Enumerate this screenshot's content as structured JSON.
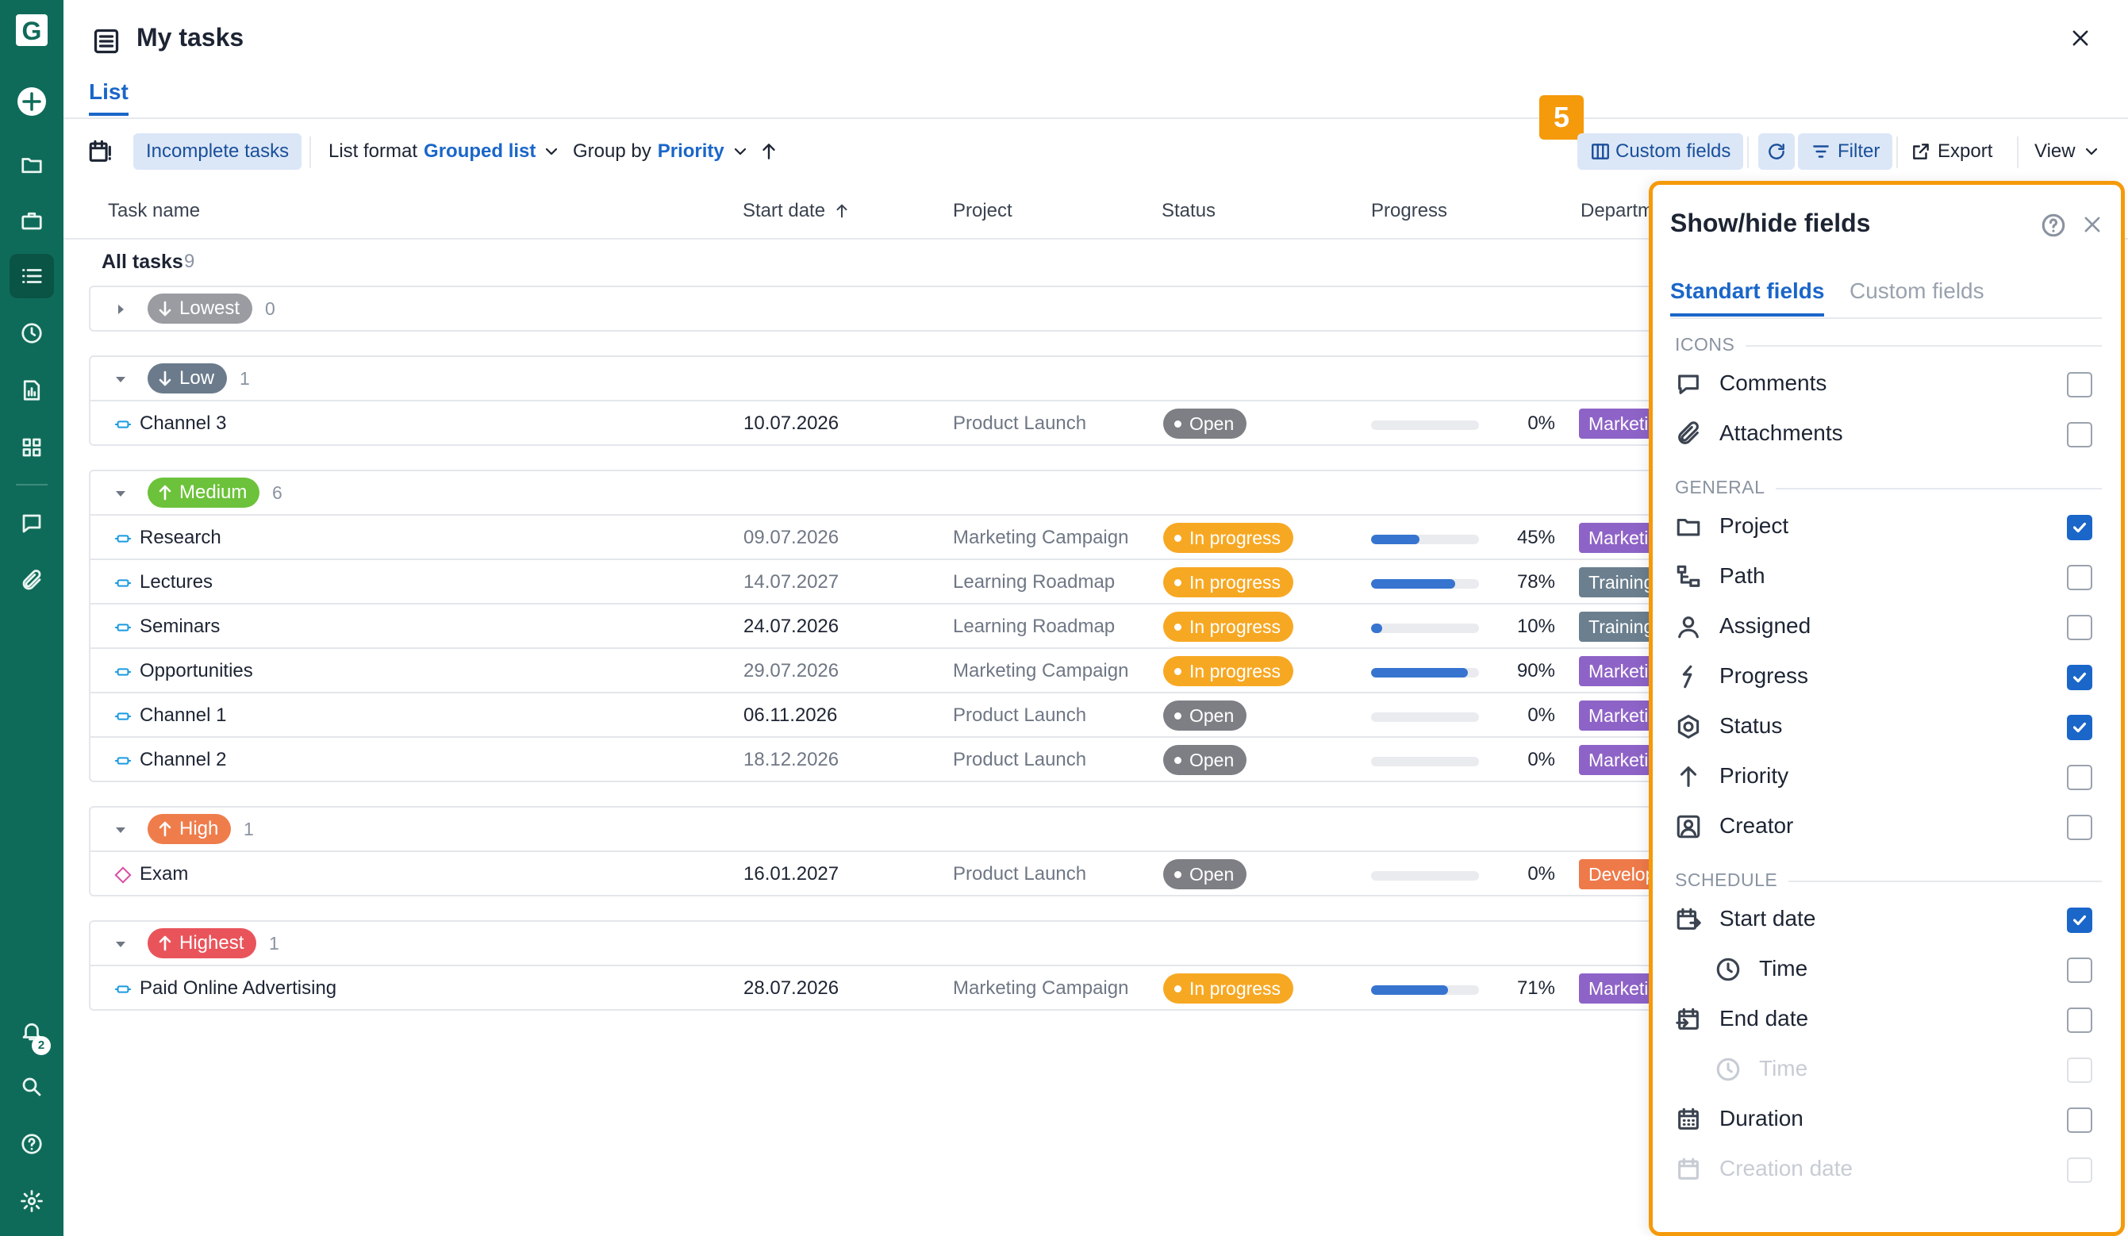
{
  "app": {
    "logo_letter": "G"
  },
  "header": {
    "title": "My tasks",
    "tab": "List",
    "step_badge": "5"
  },
  "toolbar": {
    "incomplete": "Incomplete tasks",
    "list_format_label": "List format",
    "list_format_value": "Grouped list",
    "group_by_label": "Group by",
    "group_by_value": "Priority",
    "custom_fields": "Custom fields",
    "filter": "Filter",
    "export": "Export",
    "view": "View"
  },
  "columns": [
    "Task name",
    "Start date",
    "Project",
    "Status",
    "Progress",
    "Department"
  ],
  "summary": {
    "label": "All tasks",
    "count": "9"
  },
  "groups": [
    {
      "priority": "Lowest",
      "count": "0",
      "color": "#9a9ca2",
      "collapsed": true,
      "arrow": "down",
      "tasks": []
    },
    {
      "priority": "Low",
      "count": "1",
      "color": "#6b7b8c",
      "collapsed": false,
      "arrow": "down",
      "tasks": [
        {
          "name": "Channel 3",
          "start": "10.07.2026",
          "start_dark": true,
          "project": "Product Launch",
          "status": "Open",
          "progress": 0,
          "progress_text": "0%",
          "department": "Marketing",
          "dept_color": "#8e63c7"
        }
      ]
    },
    {
      "priority": "Medium",
      "count": "6",
      "color": "#6cc23a",
      "collapsed": false,
      "arrow": "up",
      "tasks": [
        {
          "name": "Research",
          "start": "09.07.2026",
          "start_dark": false,
          "project": "Marketing Campaign",
          "status": "In progress",
          "progress": 45,
          "progress_text": "45%",
          "department": "Marketing",
          "dept_color": "#8e63c7"
        },
        {
          "name": "Lectures",
          "start": "14.07.2027",
          "start_dark": false,
          "project": "Learning Roadmap",
          "status": "In progress",
          "progress": 78,
          "progress_text": "78%",
          "department": "Training",
          "dept_color": "#6b7f8e"
        },
        {
          "name": "Seminars",
          "start": "24.07.2026",
          "start_dark": true,
          "project": "Learning Roadmap",
          "status": "In progress",
          "progress": 10,
          "progress_text": "10%",
          "department": "Training",
          "dept_color": "#6b7f8e"
        },
        {
          "name": "Opportunities",
          "start": "29.07.2026",
          "start_dark": false,
          "project": "Marketing Campaign",
          "status": "In progress",
          "progress": 90,
          "progress_text": "90%",
          "department": "Marketing",
          "dept_color": "#8e63c7"
        },
        {
          "name": "Channel 1",
          "start": "06.11.2026",
          "start_dark": true,
          "project": "Product Launch",
          "status": "Open",
          "progress": 0,
          "progress_text": "0%",
          "department": "Marketing",
          "dept_color": "#8e63c7"
        },
        {
          "name": "Channel 2",
          "start": "18.12.2026",
          "start_dark": false,
          "project": "Product Launch",
          "status": "Open",
          "progress": 0,
          "progress_text": "0%",
          "department": "Marketing",
          "dept_color": "#8e63c7"
        }
      ]
    },
    {
      "priority": "High",
      "count": "1",
      "color": "#ef7d4c",
      "collapsed": false,
      "arrow": "up",
      "tasks": [
        {
          "name": "Exam",
          "start": "16.01.2027",
          "start_dark": true,
          "project": "Product Launch",
          "status": "Open",
          "progress": 0,
          "progress_text": "0%",
          "department": "Development",
          "dept_color": "#ee7a4a",
          "milestone": true
        }
      ]
    },
    {
      "priority": "Highest",
      "count": "1",
      "color": "#e9545b",
      "collapsed": false,
      "arrow": "up",
      "tasks": [
        {
          "name": "Paid Online Advertising",
          "start": "28.07.2026",
          "start_dark": true,
          "project": "Marketing Campaign",
          "status": "In progress",
          "progress": 71,
          "progress_text": "71%",
          "department": "Marketing",
          "dept_color": "#8e63c7"
        }
      ]
    }
  ],
  "panel": {
    "title": "Show/hide fields",
    "tab_standard": "Standart fields",
    "tab_custom": "Custom fields",
    "sections": [
      {
        "title": "ICONS",
        "fields": [
          {
            "label": "Comments",
            "icon": "comment-icon",
            "checked": false
          },
          {
            "label": "Attachments",
            "icon": "paperclip-icon",
            "checked": false
          }
        ]
      },
      {
        "title": "GENERAL",
        "fields": [
          {
            "label": "Project",
            "icon": "folder-icon",
            "checked": true
          },
          {
            "label": "Path",
            "icon": "path-icon",
            "checked": false
          },
          {
            "label": "Assigned",
            "icon": "person-icon",
            "checked": false
          },
          {
            "label": "Progress",
            "icon": "progress-icon",
            "checked": true
          },
          {
            "label": "Status",
            "icon": "status-icon",
            "checked": true
          },
          {
            "label": "Priority",
            "icon": "arrow-up-icon",
            "checked": false
          },
          {
            "label": "Creator",
            "icon": "creator-icon",
            "checked": false
          }
        ]
      },
      {
        "title": "SCHEDULE",
        "fields": [
          {
            "label": "Start date",
            "icon": "calendar-start-icon",
            "checked": true
          },
          {
            "label": "Time",
            "icon": "clock-icon",
            "checked": false,
            "sub": true
          },
          {
            "label": "End date",
            "icon": "calendar-end-icon",
            "checked": false
          },
          {
            "label": "Time",
            "icon": "clock-icon",
            "checked": false,
            "sub": true,
            "disabled": true
          },
          {
            "label": "Duration",
            "icon": "calendar-grid-icon",
            "checked": false
          },
          {
            "label": "Creation date",
            "icon": "calendar-icon",
            "checked": false,
            "disabled": true
          }
        ]
      }
    ]
  },
  "notifications": {
    "count": "2"
  }
}
